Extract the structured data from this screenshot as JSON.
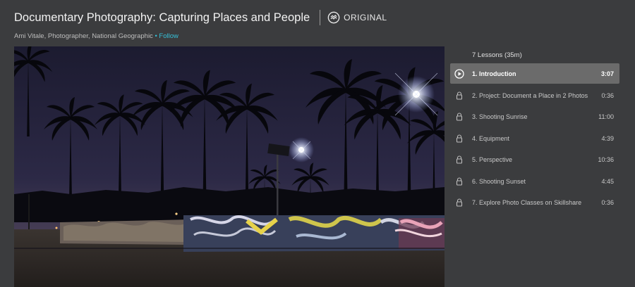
{
  "header": {
    "title": "Documentary Photography: Capturing Places and People",
    "badge": "ORIGINAL",
    "instructor": "Ami Vitale, Photographer, National Geographic",
    "separator": "•",
    "follow": "Follow"
  },
  "lessons": {
    "heading": "7 Lessons (35m)",
    "items": [
      {
        "title": "1. Introduction",
        "duration": "3:07",
        "icon": "play-icon",
        "active": true
      },
      {
        "title": "2. Project: Document a Place in 2 Photos",
        "duration": "0:36",
        "icon": "lock-icon"
      },
      {
        "title": "3. Shooting Sunrise",
        "duration": "11:00",
        "icon": "lock-icon"
      },
      {
        "title": "4. Equipment",
        "duration": "4:39",
        "icon": "lock-icon"
      },
      {
        "title": "5. Perspective",
        "duration": "10:36",
        "icon": "lock-icon"
      },
      {
        "title": "6. Shooting Sunset",
        "duration": "4:45",
        "icon": "lock-icon"
      },
      {
        "title": "7. Explore Photo Classes on Skillshare",
        "duration": "0:36",
        "icon": "lock-icon"
      }
    ]
  },
  "colors": {
    "background": "#3b3c3e",
    "active_item": "#6b6b6b",
    "follow_link": "#36c0d8"
  }
}
